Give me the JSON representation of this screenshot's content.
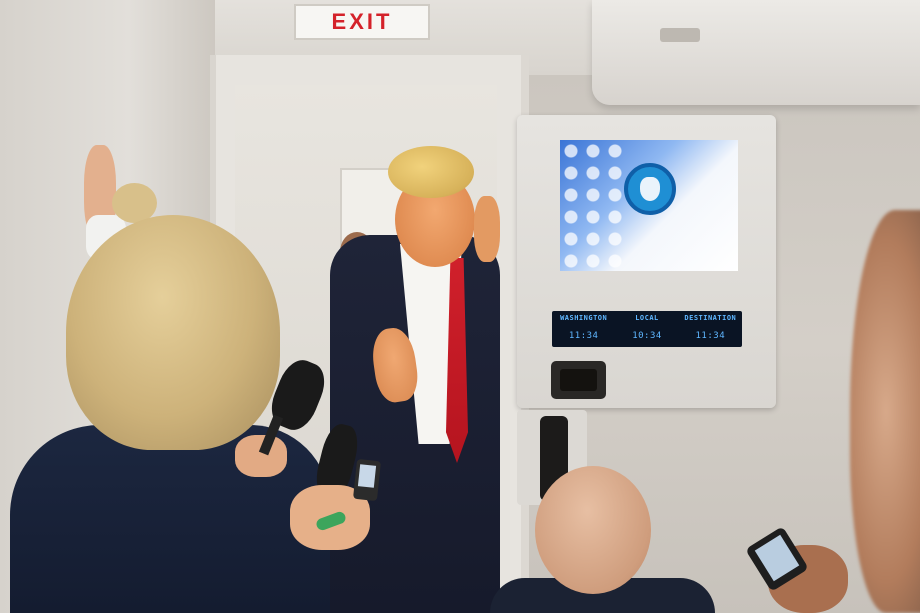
{
  "scene": {
    "exit_sign": "EXIT",
    "clock_panel": {
      "labels": [
        "WASHINGTON",
        "LOCAL",
        "DESTINATION"
      ],
      "times": [
        "11:34",
        "10:34",
        "11:34"
      ]
    }
  },
  "colors": {
    "exit_red": "#d4222a",
    "screen_blue": "#1f8fd4",
    "clock_text": "#5fb6ff",
    "tie_red": "#d0202b",
    "suit_navy": "#1f2438"
  }
}
